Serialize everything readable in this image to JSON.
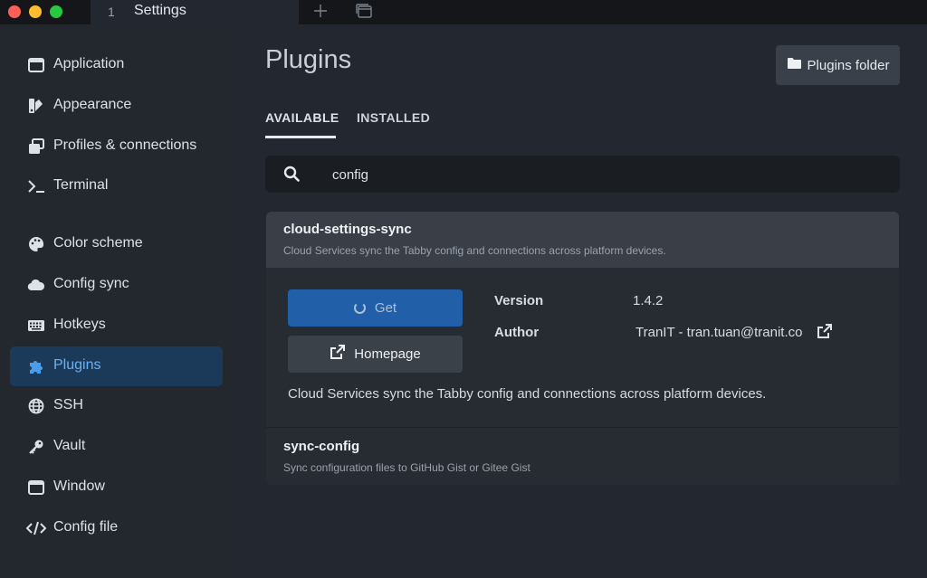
{
  "titlebar": {
    "tab_number": "1",
    "tab_title": "Settings"
  },
  "sidebar": {
    "items": [
      {
        "label": "Application",
        "icon": "window-icon"
      },
      {
        "label": "Appearance",
        "icon": "paint-swatch-icon"
      },
      {
        "label": "Profiles & connections",
        "icon": "copy-windows-icon"
      },
      {
        "label": "Terminal",
        "icon": "terminal-prompt-icon"
      },
      {
        "label": "Color scheme",
        "icon": "palette-icon"
      },
      {
        "label": "Config sync",
        "icon": "cloud-icon"
      },
      {
        "label": "Hotkeys",
        "icon": "keyboard-icon"
      },
      {
        "label": "Plugins",
        "icon": "puzzle-icon",
        "active": true
      },
      {
        "label": "SSH",
        "icon": "globe-icon"
      },
      {
        "label": "Vault",
        "icon": "key-icon"
      },
      {
        "label": "Window",
        "icon": "window-icon"
      },
      {
        "label": "Config file",
        "icon": "code-icon"
      }
    ]
  },
  "main": {
    "title": "Plugins",
    "plugins_folder_label": "Plugins folder",
    "tabs": [
      {
        "label": "AVAILABLE",
        "active": true
      },
      {
        "label": "INSTALLED",
        "active": false
      }
    ],
    "search": {
      "value": "config"
    },
    "plugins": [
      {
        "name": "cloud-settings-sync",
        "description": "Cloud Services sync the Tabby config and connections across platform devices.",
        "expanded": true,
        "get_label": "Get",
        "homepage_label": "Homepage",
        "version_label": "Version",
        "version": "1.4.2",
        "author_label": "Author",
        "author": "TranIT - tran.tuan@tranit.co",
        "long_description": "Cloud Services sync the Tabby config and connections across platform devices."
      },
      {
        "name": "sync-config",
        "description": "Sync configuration files to GitHub Gist or Gitee Gist",
        "expanded": false
      }
    ]
  },
  "colors": {
    "background": "#232830",
    "titlebar": "#141619",
    "accent": "#6ab1f3",
    "active_nav": "#1b3a5a",
    "primary_button": "#2160a8"
  }
}
